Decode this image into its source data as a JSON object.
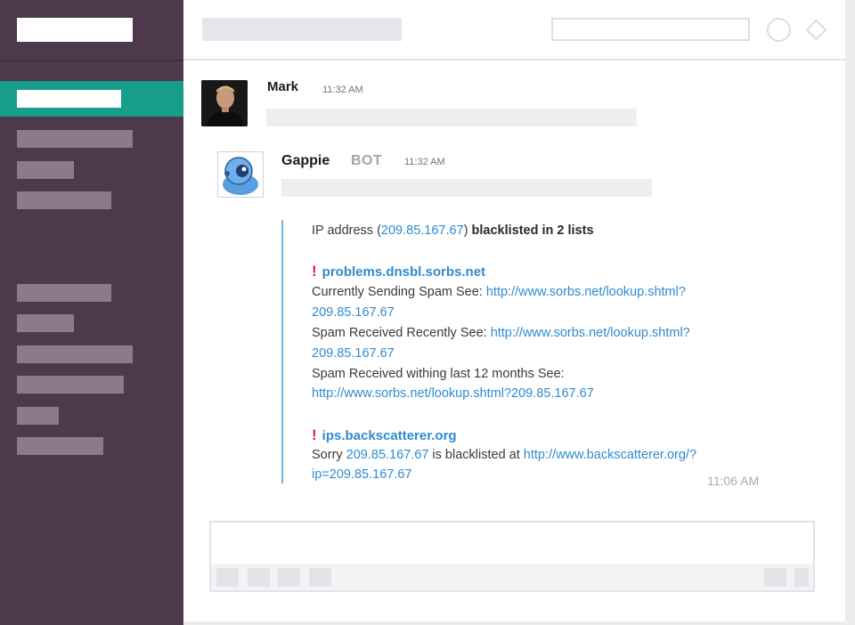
{
  "messages": {
    "first": {
      "sender": "Mark",
      "time": "11:32 AM"
    },
    "bot": {
      "sender": "Gappie",
      "tag": "BOT",
      "time": "11:32 AM",
      "summary": {
        "prefix": "IP address (",
        "ip": "209.85.167.67",
        "mid": ") ",
        "result": "blacklisted in 2 lists"
      },
      "lists": [
        {
          "name": "problems.dnsbl.sorbs.net",
          "entries": [
            {
              "label": "Currently Sending Spam See: ",
              "url_line1": "http://www.sorbs.net/lookup.shtml?",
              "url_line2": "209.85.167.67"
            },
            {
              "label": "Spam Received Recently See: ",
              "url_line1": "http://www.sorbs.net/lookup.shtml?",
              "url_line2": "209.85.167.67"
            },
            {
              "label": "Spam Received withing last 12 months See:",
              "url_line2": "http://www.sorbs.net/lookup.shtml?209.85.167.67"
            }
          ]
        },
        {
          "name": "ips.backscatterer.org",
          "text_prefix": "Sorry ",
          "ip": "209.85.167.67",
          "text_mid": " is blacklisted at ",
          "url_line1": "http://www.backscatterer.org/?",
          "url_line2": "ip=209.85.167.67"
        }
      ],
      "footer_time": "11:06 AM"
    }
  },
  "icons": {
    "header_circle": "circle-icon",
    "header_diamond": "diamond-icon",
    "alert": "exclamation-icon"
  },
  "colors": {
    "sidebar": "#4d394b",
    "active": "#179e8b",
    "link": "#2f8bd0",
    "alert": "#d8253d",
    "quote_bar": "#76b6e0"
  }
}
